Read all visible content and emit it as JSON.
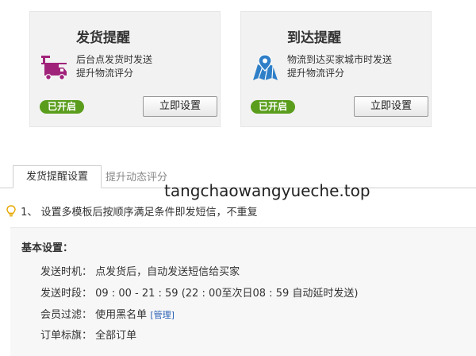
{
  "cards": [
    {
      "title": "发货提醒",
      "desc_line1": "后台点发货时发送",
      "desc_line2": "提升物流评分",
      "status": "已开启",
      "button": "立即设置",
      "icon": "truck-icon",
      "icon_color": "#a0237a"
    },
    {
      "title": "到达提醒",
      "desc_line1": "物流到达买家城市时发送",
      "desc_line2": "提升物流评分",
      "status": "已开启",
      "button": "立即设置",
      "icon": "map-pin-icon",
      "icon_color": "#2f7fc8"
    }
  ],
  "watermark": "tangchaowangyueche.top",
  "tabs": [
    {
      "label": "发货提醒设置",
      "active": true
    },
    {
      "label": "提升动态评分",
      "active": false
    }
  ],
  "notice": "1、 设置多模板后按顺序满足条件即发短信，不重复",
  "settings": {
    "heading": "基本设置：",
    "rows": [
      {
        "label": "发送时机：",
        "value": "点发货后，自动发送短信给买家"
      },
      {
        "label": "发送时段：",
        "value": "09 : 00 - 21 : 59 (22 : 00至次日08 : 59 自动延时发送)"
      },
      {
        "label": "会员过滤：",
        "value": "使用黑名单",
        "link": "[管理]"
      },
      {
        "label": "订单标旗：",
        "value": "全部订单"
      }
    ]
  },
  "colors": {
    "badge_green": "#5a9d1c",
    "link_blue": "#2a62b8"
  }
}
